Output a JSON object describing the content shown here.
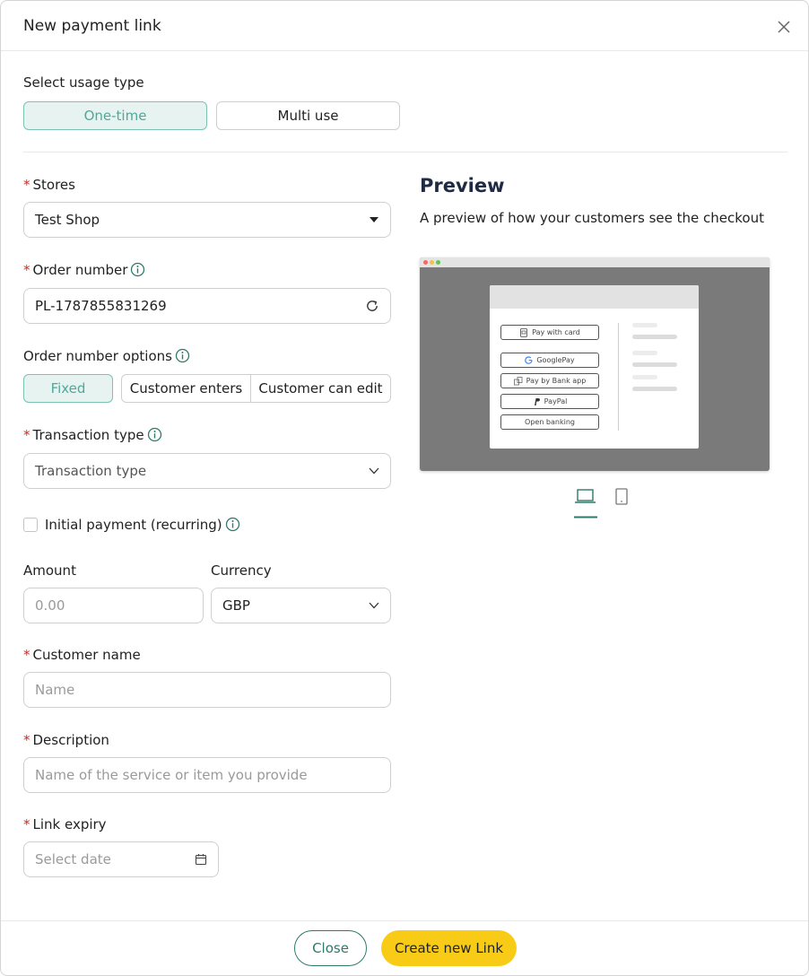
{
  "header": {
    "title": "New payment link"
  },
  "usage": {
    "label": "Select usage type",
    "options": [
      "One-time",
      "Multi use"
    ],
    "selected": "One-time"
  },
  "stores": {
    "label": "Stores",
    "value": "Test Shop"
  },
  "order_number": {
    "label": "Order number",
    "value": "PL-1787855831269"
  },
  "order_options": {
    "label": "Order number options",
    "options": [
      "Fixed",
      "Customer enters",
      "Customer can edit"
    ],
    "selected": "Fixed"
  },
  "transaction": {
    "label": "Transaction type",
    "placeholder": "Transaction type"
  },
  "recurring": {
    "label": "Initial payment (recurring)",
    "checked": false
  },
  "amount": {
    "label": "Amount",
    "placeholder": "0.00"
  },
  "currency": {
    "label": "Currency",
    "value": "GBP"
  },
  "customer": {
    "label": "Customer name",
    "placeholder": "Name"
  },
  "description": {
    "label": "Description",
    "placeholder": "Name of the service or item you provide"
  },
  "expiry": {
    "label": "Link expiry",
    "placeholder": "Select date"
  },
  "preview": {
    "title": "Preview",
    "subtitle": "A preview of how your customers see the checkout",
    "methods": [
      "Pay with card",
      "GooglePay",
      "Pay by Bank app",
      "PayPal",
      "Open banking"
    ],
    "selected_device": "desktop"
  },
  "footer": {
    "close_label": "Close",
    "create_label": "Create new Link"
  },
  "colors": {
    "accent": "#2d7a6a",
    "accent_light": "#e6f3f0",
    "primary_button": "#f7cb16",
    "required": "#e02020"
  }
}
